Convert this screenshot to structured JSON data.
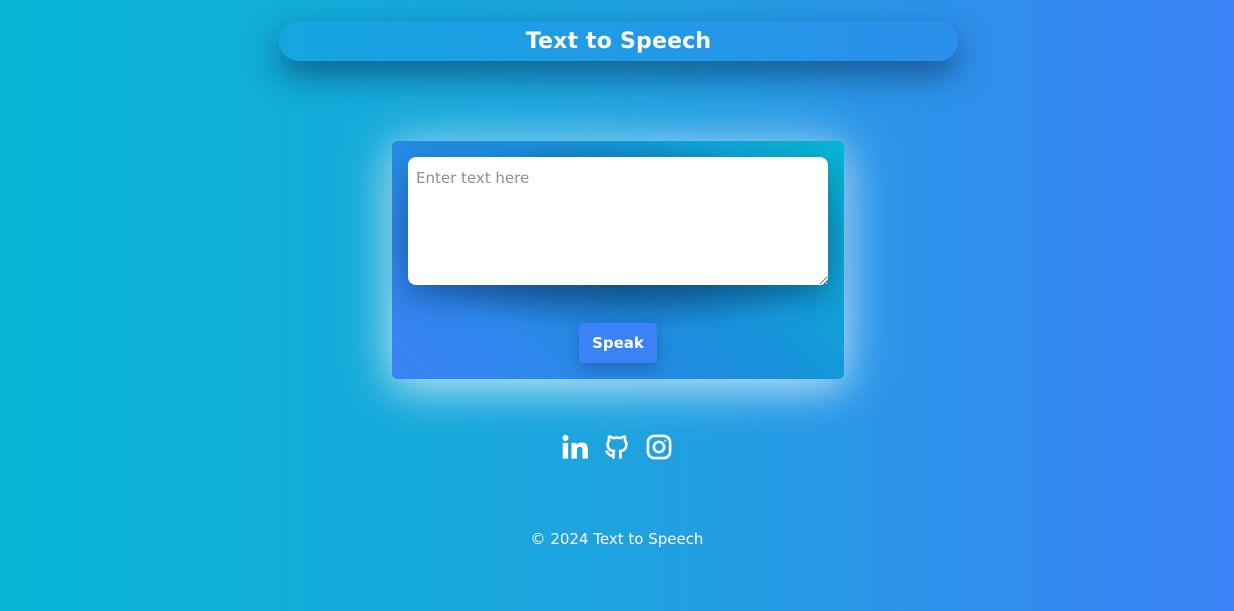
{
  "header": {
    "title": "Text to Speech"
  },
  "main": {
    "textarea": {
      "placeholder": "Enter text here",
      "value": ""
    },
    "speak_label": "Speak"
  },
  "socials": [
    {
      "name": "LinkedIn",
      "icon": "linkedin-icon"
    },
    {
      "name": "GitHub",
      "icon": "github-icon"
    },
    {
      "name": "Instagram",
      "icon": "instagram-icon"
    }
  ],
  "footer": {
    "text": "© 2024 Text to Speech"
  },
  "colors": {
    "background_start": "#06b6d4",
    "background_end": "#3b82f6",
    "button": "#3b82f6",
    "text": "#ffffff"
  }
}
